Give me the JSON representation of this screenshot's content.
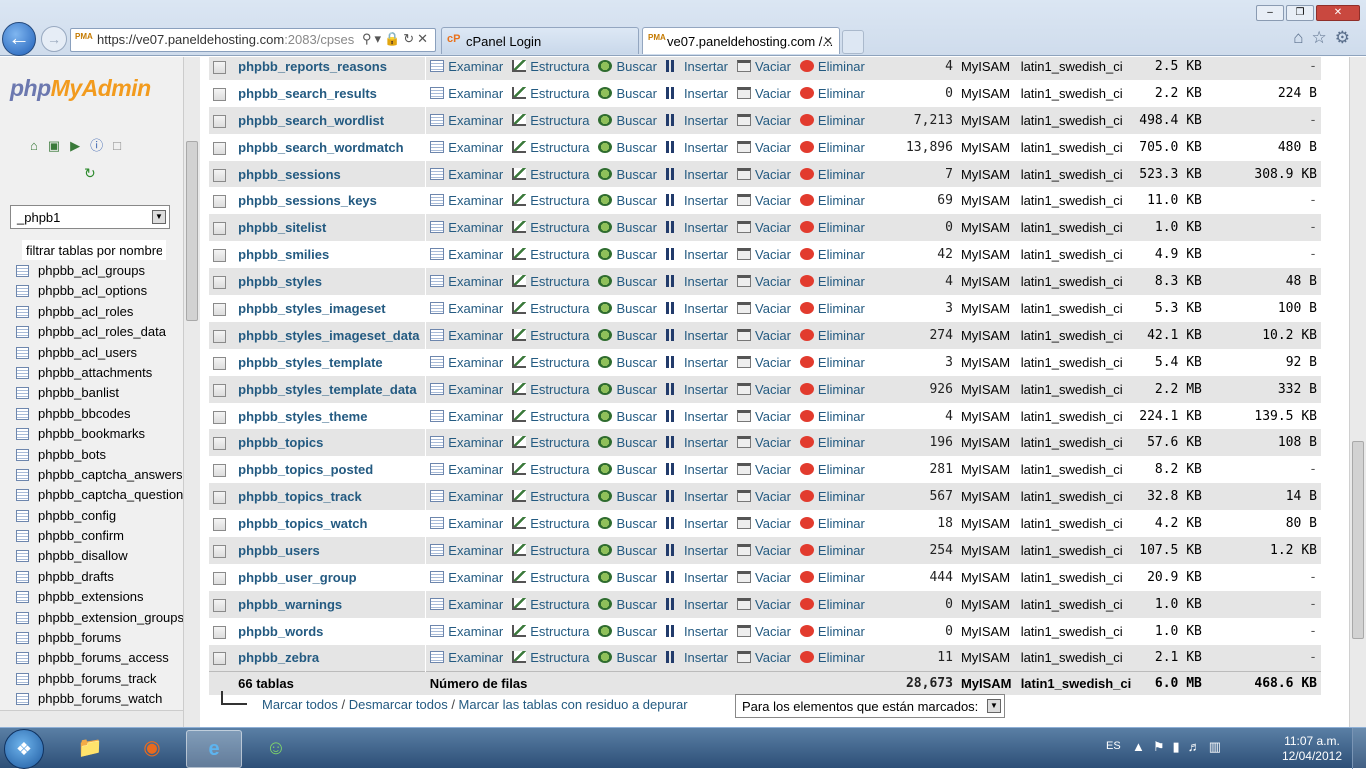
{
  "browser": {
    "url_host": "https://ve07.paneldehosting.com",
    "url_rest": ":2083/cpses",
    "favicon_label": "PMA",
    "tabs": [
      {
        "label": "cPanel Login",
        "icon": "cP"
      },
      {
        "label": "ve07.paneldehosting.com /...",
        "icon": "PMA"
      }
    ],
    "window_buttons": [
      "–",
      "❐",
      "✕"
    ],
    "tools_icons": [
      "home-icon",
      "star-icon",
      "gear-icon"
    ]
  },
  "sidebar": {
    "logo_php": "php",
    "logo_myadmin": "MyAdmin",
    "database_selected": "_phpb1",
    "filter_placeholder": "filtrar tablas por nombre",
    "tables": [
      "phpbb_acl_groups",
      "phpbb_acl_options",
      "phpbb_acl_roles",
      "phpbb_acl_roles_data",
      "phpbb_acl_users",
      "phpbb_attachments",
      "phpbb_banlist",
      "phpbb_bbcodes",
      "phpbb_bookmarks",
      "phpbb_bots",
      "phpbb_captcha_answers",
      "phpbb_captcha_questions",
      "phpbb_config",
      "phpbb_confirm",
      "phpbb_disallow",
      "phpbb_drafts",
      "phpbb_extensions",
      "phpbb_extension_groups",
      "phpbb_forums",
      "phpbb_forums_access",
      "phpbb_forums_track",
      "phpbb_forums_watch"
    ]
  },
  "actions": {
    "browse": "Examinar",
    "structure": "Estructura",
    "search": "Buscar",
    "insert": "Insertar",
    "empty": "Vaciar",
    "drop": "Eliminar"
  },
  "rows": [
    {
      "name": "phpbb_reports_reasons",
      "rows": "4",
      "engine": "MyISAM",
      "collation": "latin1_swedish_ci",
      "size": "2.5 KB",
      "overhead": "-"
    },
    {
      "name": "phpbb_search_results",
      "rows": "0",
      "engine": "MyISAM",
      "collation": "latin1_swedish_ci",
      "size": "2.2 KB",
      "overhead": "224 B"
    },
    {
      "name": "phpbb_search_wordlist",
      "rows": "7,213",
      "engine": "MyISAM",
      "collation": "latin1_swedish_ci",
      "size": "498.4 KB",
      "overhead": "-"
    },
    {
      "name": "phpbb_search_wordmatch",
      "rows": "13,896",
      "engine": "MyISAM",
      "collation": "latin1_swedish_ci",
      "size": "705.0 KB",
      "overhead": "480 B"
    },
    {
      "name": "phpbb_sessions",
      "rows": "7",
      "engine": "MyISAM",
      "collation": "latin1_swedish_ci",
      "size": "523.3 KB",
      "overhead": "308.9 KB"
    },
    {
      "name": "phpbb_sessions_keys",
      "rows": "69",
      "engine": "MyISAM",
      "collation": "latin1_swedish_ci",
      "size": "11.0 KB",
      "overhead": "-"
    },
    {
      "name": "phpbb_sitelist",
      "rows": "0",
      "engine": "MyISAM",
      "collation": "latin1_swedish_ci",
      "size": "1.0 KB",
      "overhead": "-"
    },
    {
      "name": "phpbb_smilies",
      "rows": "42",
      "engine": "MyISAM",
      "collation": "latin1_swedish_ci",
      "size": "4.9 KB",
      "overhead": "-"
    },
    {
      "name": "phpbb_styles",
      "rows": "4",
      "engine": "MyISAM",
      "collation": "latin1_swedish_ci",
      "size": "8.3 KB",
      "overhead": "48 B"
    },
    {
      "name": "phpbb_styles_imageset",
      "rows": "3",
      "engine": "MyISAM",
      "collation": "latin1_swedish_ci",
      "size": "5.3 KB",
      "overhead": "100 B"
    },
    {
      "name": "phpbb_styles_imageset_data",
      "rows": "274",
      "engine": "MyISAM",
      "collation": "latin1_swedish_ci",
      "size": "42.1 KB",
      "overhead": "10.2 KB"
    },
    {
      "name": "phpbb_styles_template",
      "rows": "3",
      "engine": "MyISAM",
      "collation": "latin1_swedish_ci",
      "size": "5.4 KB",
      "overhead": "92 B"
    },
    {
      "name": "phpbb_styles_template_data",
      "rows": "926",
      "engine": "MyISAM",
      "collation": "latin1_swedish_ci",
      "size": "2.2 MB",
      "overhead": "332 B"
    },
    {
      "name": "phpbb_styles_theme",
      "rows": "4",
      "engine": "MyISAM",
      "collation": "latin1_swedish_ci",
      "size": "224.1 KB",
      "overhead": "139.5 KB"
    },
    {
      "name": "phpbb_topics",
      "rows": "196",
      "engine": "MyISAM",
      "collation": "latin1_swedish_ci",
      "size": "57.6 KB",
      "overhead": "108 B"
    },
    {
      "name": "phpbb_topics_posted",
      "rows": "281",
      "engine": "MyISAM",
      "collation": "latin1_swedish_ci",
      "size": "8.2 KB",
      "overhead": "-"
    },
    {
      "name": "phpbb_topics_track",
      "rows": "567",
      "engine": "MyISAM",
      "collation": "latin1_swedish_ci",
      "size": "32.8 KB",
      "overhead": "14 B"
    },
    {
      "name": "phpbb_topics_watch",
      "rows": "18",
      "engine": "MyISAM",
      "collation": "latin1_swedish_ci",
      "size": "4.2 KB",
      "overhead": "80 B"
    },
    {
      "name": "phpbb_users",
      "rows": "254",
      "engine": "MyISAM",
      "collation": "latin1_swedish_ci",
      "size": "107.5 KB",
      "overhead": "1.2 KB"
    },
    {
      "name": "phpbb_user_group",
      "rows": "444",
      "engine": "MyISAM",
      "collation": "latin1_swedish_ci",
      "size": "20.9 KB",
      "overhead": "-"
    },
    {
      "name": "phpbb_warnings",
      "rows": "0",
      "engine": "MyISAM",
      "collation": "latin1_swedish_ci",
      "size": "1.0 KB",
      "overhead": "-"
    },
    {
      "name": "phpbb_words",
      "rows": "0",
      "engine": "MyISAM",
      "collation": "latin1_swedish_ci",
      "size": "1.0 KB",
      "overhead": "-"
    },
    {
      "name": "phpbb_zebra",
      "rows": "11",
      "engine": "MyISAM",
      "collation": "latin1_swedish_ci",
      "size": "2.1 KB",
      "overhead": "-"
    }
  ],
  "footer": {
    "tables_count": "66 tablas",
    "rows_label": "Número de filas",
    "total_rows": "28,673",
    "engine": "MyISAM",
    "collation": "latin1_swedish_ci",
    "total_size": "6.0 MB",
    "total_overhead": "468.6 KB"
  },
  "bottom": {
    "check_all": "Marcar todos",
    "uncheck_all": "Desmarcar todos",
    "check_overhead": "Marcar las tablas con residuo a depurar",
    "sep": " / ",
    "with_selected": "Para los elementos que están marcados:"
  },
  "taskbar": {
    "language": "ES",
    "time": "11:07 a.m.",
    "date": "12/04/2012"
  }
}
